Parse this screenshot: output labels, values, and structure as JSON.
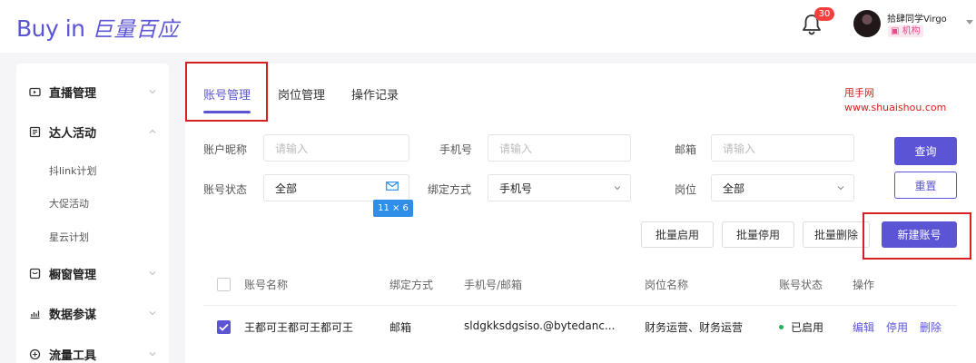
{
  "header": {
    "logo_en": "Buy in",
    "logo_cn": "巨量百应",
    "notification_count": "30",
    "username": "拾肆同学Virgo",
    "role": "机构"
  },
  "sidebar": {
    "items": [
      {
        "label": "直播管理",
        "icon": "live-icon",
        "expanded": false
      },
      {
        "label": "达人活动",
        "icon": "activity-icon",
        "expanded": true
      },
      {
        "label": "橱窗管理",
        "icon": "window-icon",
        "expanded": false
      },
      {
        "label": "数据参谋",
        "icon": "data-icon",
        "expanded": false
      },
      {
        "label": "流量工具",
        "icon": "traffic-icon",
        "expanded": false
      }
    ],
    "sub_items": [
      "抖link计划",
      "大促活动",
      "星云计划"
    ]
  },
  "tabs": [
    {
      "label": "账号管理",
      "active": true
    },
    {
      "label": "岗位管理",
      "active": false
    },
    {
      "label": "操作记录",
      "active": false
    }
  ],
  "filters": {
    "nickname_label": "账户昵称",
    "nickname_placeholder": "请输入",
    "phone_label": "手机号",
    "phone_placeholder": "请输入",
    "email_label": "邮箱",
    "email_placeholder": "请输入",
    "status_label": "账号状态",
    "status_value": "全部",
    "bind_label": "绑定方式",
    "bind_value": "手机号",
    "position_label": "岗位",
    "position_value": "全部"
  },
  "buttons": {
    "query": "查询",
    "reset": "重置",
    "batch_enable": "批量启用",
    "batch_disable": "批量停用",
    "batch_delete": "批量删除",
    "create_account": "新建账号"
  },
  "size_tooltip": "11 × 6",
  "table": {
    "headers": [
      "账号名称",
      "绑定方式",
      "手机号/邮箱",
      "岗位名称",
      "账号状态",
      "操作"
    ],
    "rows": [
      {
        "name": "王都可王都可王都可王",
        "bind": "邮箱",
        "contact": "sldgkksdgsiso.@bytedanc...",
        "position": "财务运营、财务运营",
        "status": "已启用",
        "checked": true,
        "actions": [
          "编辑",
          "停用",
          "删除"
        ]
      }
    ]
  },
  "watermark": {
    "line1": "甩手网",
    "line2": "www.shuaishou.com"
  },
  "colors": {
    "accent": "#5b55d6",
    "highlight_box": "#d61f1f",
    "status_ok": "#22b05a",
    "badge": "#f5413e"
  }
}
